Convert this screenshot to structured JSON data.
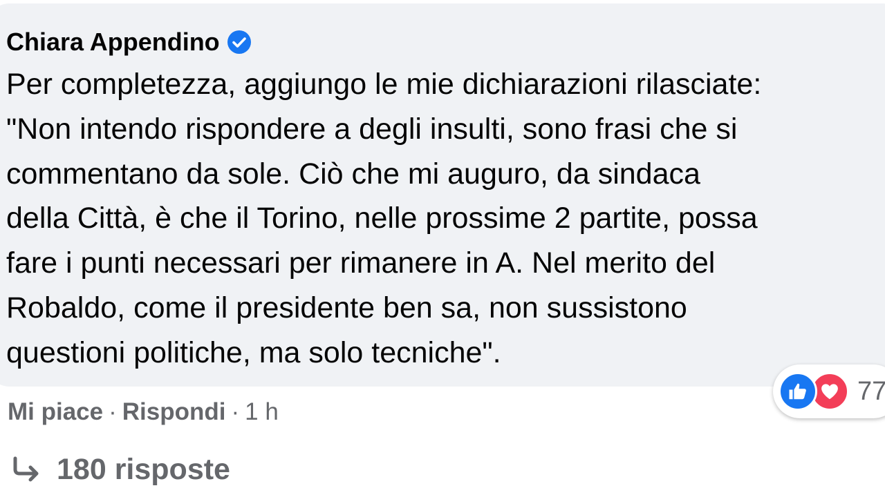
{
  "comment": {
    "author": "Chiara Appendino",
    "verified_icon": "verified-badge-icon",
    "lines": [
      "Per completezza, aggiungo le mie dichiarazioni rilasciate:",
      "\"Non intendo rispondere a degli insulti, sono frasi che si",
      "commentano da sole. Ciò che mi auguro, da sindaca",
      "della Città, è che il Torino, nelle prossime 2 partite, possa",
      "fare i punti necessari per rimanere in A. Nel merito del",
      "Robaldo, come il presidente ben sa, non sussistono",
      "questioni politiche, ma solo tecniche\"."
    ]
  },
  "reactions": {
    "icons": [
      "like-icon",
      "love-icon"
    ],
    "count": "77"
  },
  "actions": {
    "like_label": "Mi piace",
    "separator": "·",
    "reply_label": "Rispondi",
    "time": "1 h"
  },
  "replies": {
    "label": "180 risposte"
  },
  "colors": {
    "bubble_bg": "#f0f2f5",
    "text": "#050505",
    "secondary_text": "#65676b",
    "verified": "#1877f2",
    "like": "#1877f2",
    "love": "#f33e58"
  }
}
